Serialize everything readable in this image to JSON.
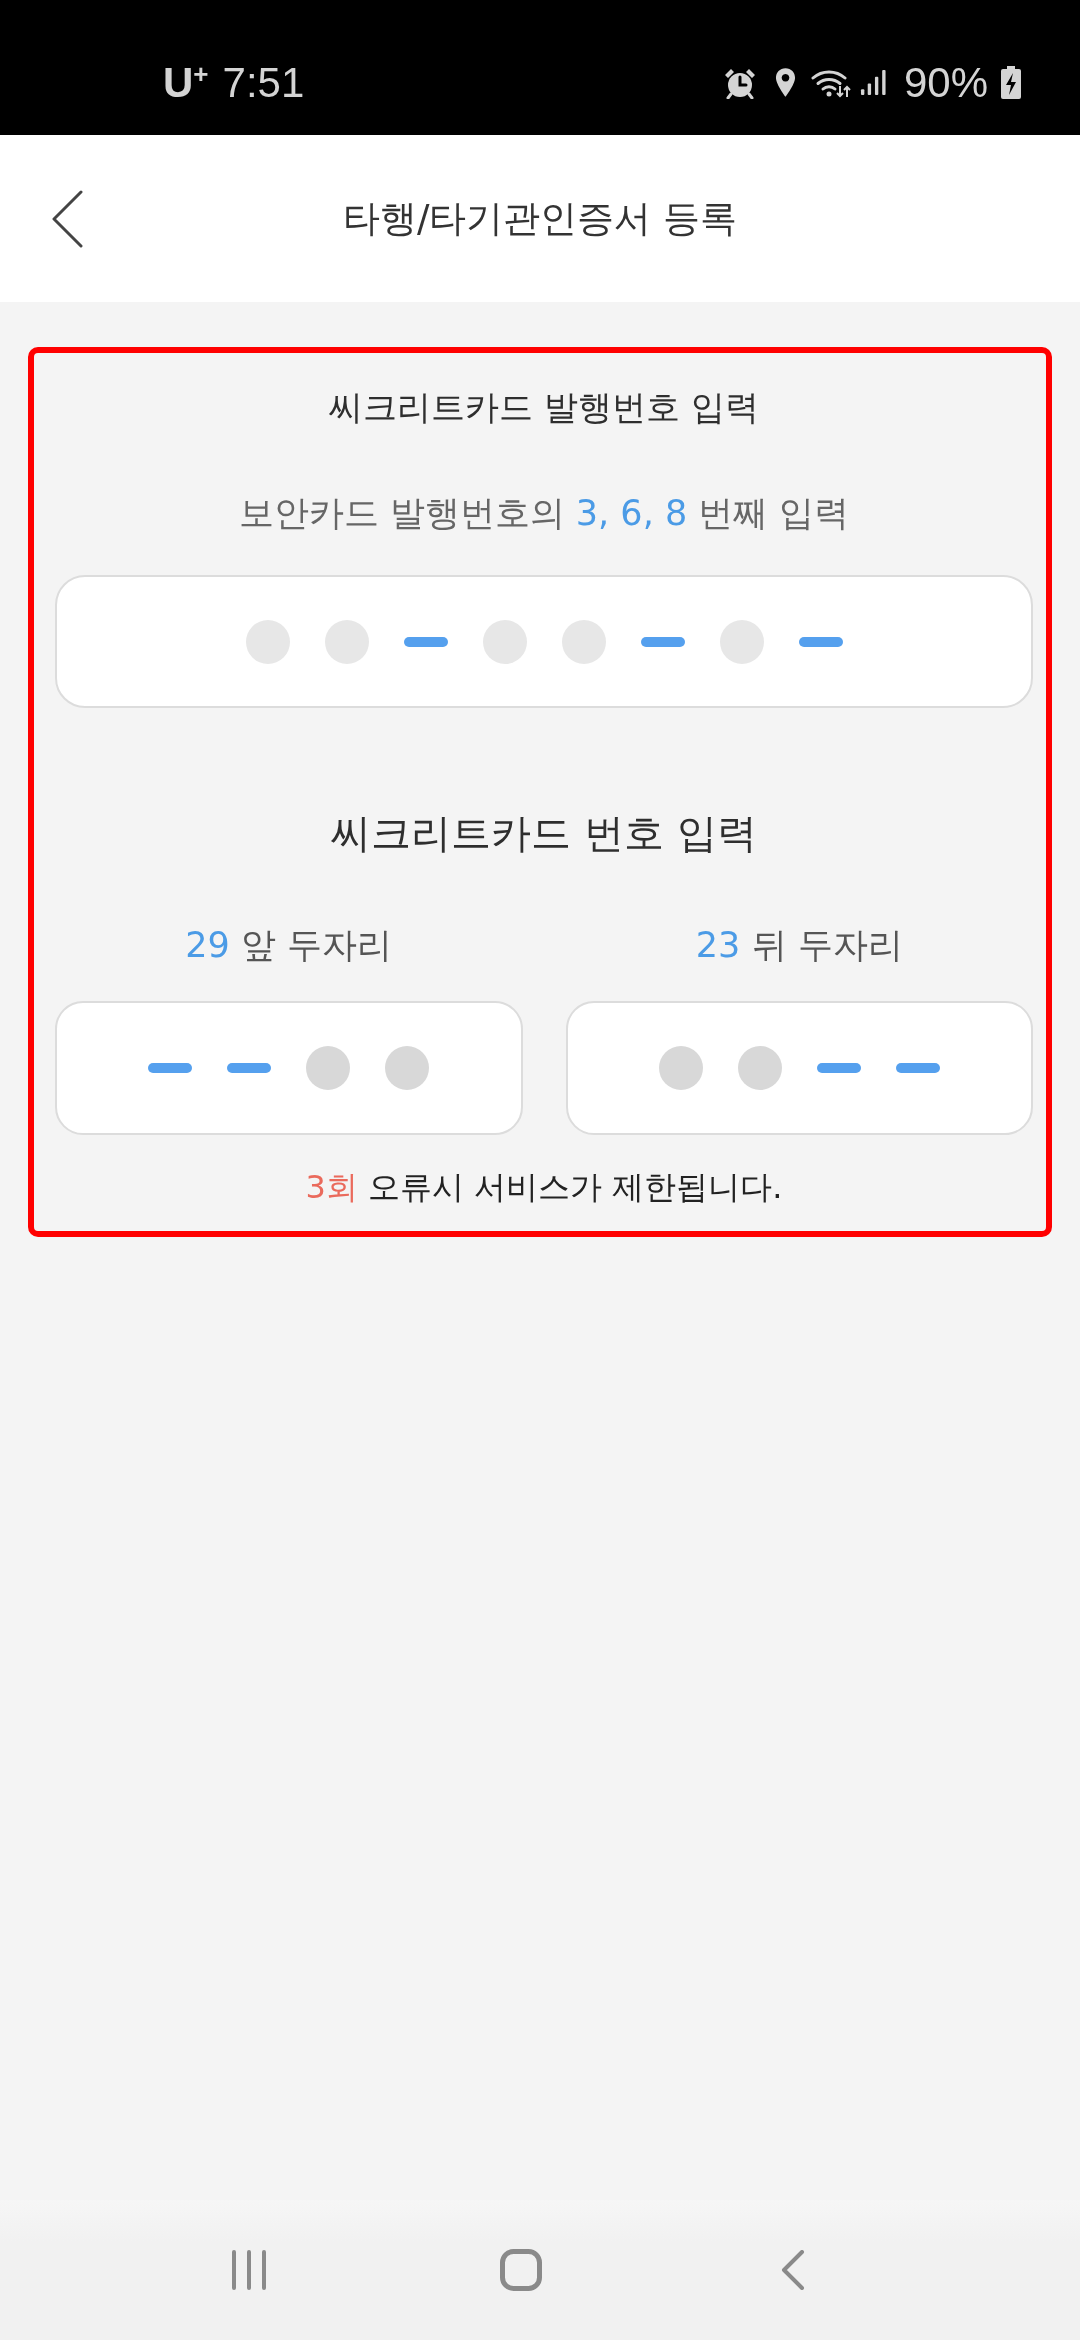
{
  "status_bar": {
    "carrier": "U$^{+}$",
    "time": "7:51",
    "battery": "90%"
  },
  "header": {
    "title": "타행/타기관인증서 등록"
  },
  "form": {
    "highlighted": true,
    "issue_number": {
      "title": "씨크리트카드 발행번호 입력",
      "instruction": [
        {
          "text": "보안카드 발행번호의",
          "emphasis": false
        },
        {
          "text": "3, 6, 8",
          "emphasis": true
        },
        {
          "text": "번째 입력",
          "emphasis": false
        }
      ],
      "field": {
        "slots": [
          {
            "kind": "hidden"
          },
          {
            "kind": "hidden"
          },
          {
            "kind": "entry"
          },
          {
            "kind": "hidden"
          },
          {
            "kind": "hidden"
          },
          {
            "kind": "entry"
          },
          {
            "kind": "hidden"
          },
          {
            "kind": "entry"
          }
        ]
      }
    },
    "card_number": {
      "title": "씨크리트카드 번호 입력",
      "groups": [
        {
          "label": [
            {
              "text": "29",
              "emphasis": true
            },
            {
              "text": "앞 두자리",
              "emphasis": false
            }
          ],
          "field": {
            "slots": [
              {
                "kind": "entry"
              },
              {
                "kind": "entry"
              },
              {
                "kind": "hidden"
              },
              {
                "kind": "hidden"
              }
            ]
          }
        },
        {
          "label": [
            {
              "text": "23",
              "emphasis": true
            },
            {
              "text": "뒤 두자리",
              "emphasis": false
            }
          ],
          "field": {
            "slots": [
              {
                "kind": "hidden"
              },
              {
                "kind": "hidden"
              },
              {
                "kind": "entry"
              },
              {
                "kind": "entry"
              }
            ]
          }
        }
      ]
    },
    "notice": [
      {
        "text": "3회",
        "emphasis": true
      },
      {
        "text": "오류시 서비스가 제한됩니다.",
        "emphasis": false
      }
    ]
  }
}
